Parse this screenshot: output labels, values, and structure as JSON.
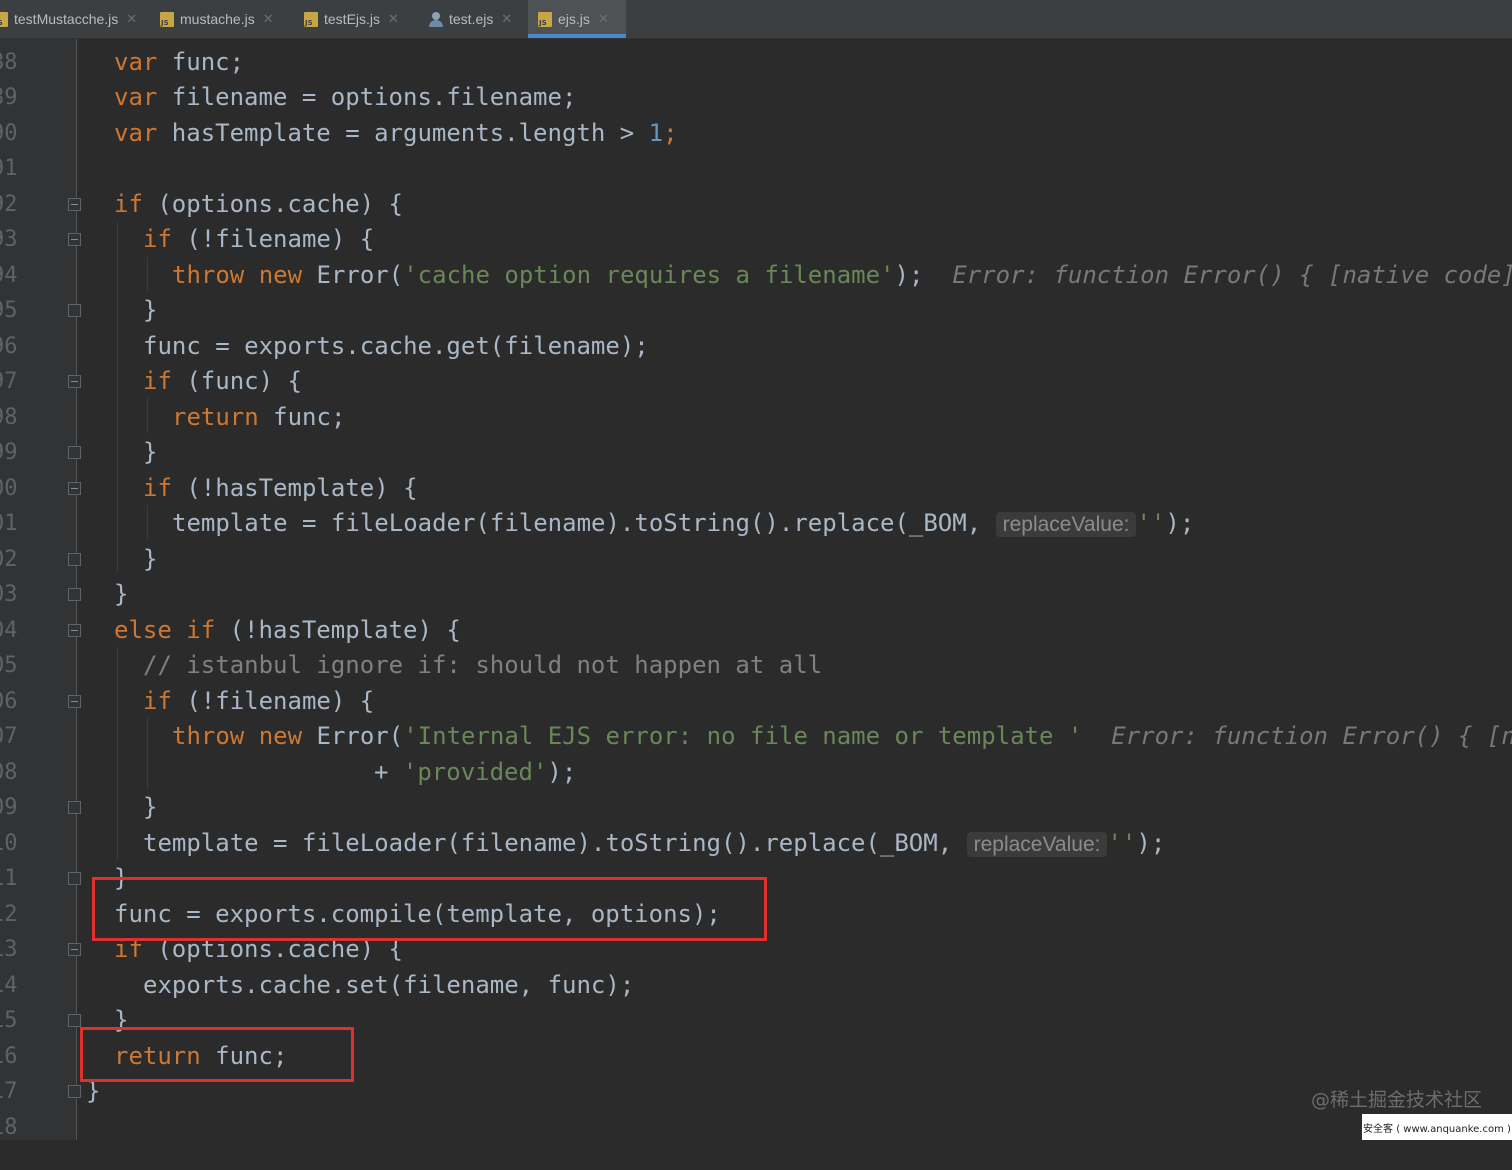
{
  "tabs": [
    {
      "label": "testMustacche.js",
      "icon": "js-file-icon",
      "active": false
    },
    {
      "label": "mustache.js",
      "icon": "js-file-icon",
      "active": false
    },
    {
      "label": "testEjs.js",
      "icon": "js-file-icon",
      "active": false
    },
    {
      "label": "test.ejs",
      "icon": "ejs-file-icon",
      "active": false
    },
    {
      "label": "ejs.js",
      "icon": "js-file-icon",
      "active": true
    }
  ],
  "line_numbers": [
    "88",
    "89",
    "90",
    "91",
    "92",
    "93",
    "94",
    "95",
    "96",
    "97",
    "98",
    "99",
    "00",
    "01",
    "02",
    "03",
    "04",
    "05",
    "06",
    "07",
    "08",
    "09",
    "10",
    "11",
    "12",
    "13",
    "14",
    "15",
    "16",
    "17",
    "18"
  ],
  "code": {
    "l88": {
      "kw": "var",
      "rest": " func;"
    },
    "l89": {
      "kw": "var",
      "rest": " filename = options.filename;"
    },
    "l90": {
      "kw": "var",
      "rest": " hasTemplate = arguments.length > ",
      "num": "1",
      "end": ";"
    },
    "l92": {
      "kw": "if",
      "rest": " (options.cache) {"
    },
    "l93": {
      "kw": "if",
      "rest": " (!filename) {"
    },
    "l94": {
      "kw1": "throw",
      "kw2": "new",
      "pre": " Error(",
      "str": "'cache option requires a filename'",
      "end": ");",
      "hint": "Error: function Error() { [native code]"
    },
    "l95": {
      "text": "}"
    },
    "l96": {
      "text": "func = exports.cache.get(filename);"
    },
    "l97": {
      "kw": "if",
      "rest": " (func) {"
    },
    "l98": {
      "kw": "return",
      "rest": " func;"
    },
    "l99": {
      "text": "}"
    },
    "l00": {
      "kw": "if",
      "rest": " (!hasTemplate) {"
    },
    "l01": {
      "pre": "template = fileLoader(filename).toString().replace(_BOM, ",
      "param": "replaceValue:",
      "str": "''",
      "end": ");"
    },
    "l02": {
      "text": "}"
    },
    "l03": {
      "text": "}"
    },
    "l04": {
      "kw1": "else",
      "kw2": "if",
      "rest": " (!hasTemplate) {"
    },
    "l05": {
      "comment": "// istanbul ignore if: should not happen at all"
    },
    "l06": {
      "kw": "if",
      "rest": " (!filename) {"
    },
    "l07": {
      "kw1": "throw",
      "kw2": "new",
      "pre": " Error(",
      "str": "'Internal EJS error: no file name or template '",
      "hint": "Error: function Error() { [n"
    },
    "l08": {
      "pre": "+ ",
      "str": "'provided'",
      "end": ");"
    },
    "l09": {
      "text": "}"
    },
    "l10": {
      "pre": "template = fileLoader(filename).toString().replace(_BOM, ",
      "param": "replaceValue:",
      "str": "''",
      "end": ");"
    },
    "l11": {
      "text": "}"
    },
    "l12": {
      "text": "func = exports.compile(template, options);"
    },
    "l13": {
      "kw": "if",
      "rest": " (options.cache) {"
    },
    "l14": {
      "text": "exports.cache.set(filename, func);"
    },
    "l15": {
      "text": "}"
    },
    "l16": {
      "kw": "return",
      "rest": " func;"
    },
    "l17": {
      "text": "}"
    }
  },
  "watermark": "@稀土掘金技术社区",
  "watermark_strip": "安全客 ( www.anquanke.com )",
  "colors": {
    "background": "#2b2b2b",
    "keyword": "#cc7832",
    "string": "#6a8759",
    "number": "#6897bb",
    "comment": "#808080",
    "text": "#a9b7c6",
    "highlight_box": "#e0302c",
    "active_tab_underline": "#4a88c7"
  }
}
